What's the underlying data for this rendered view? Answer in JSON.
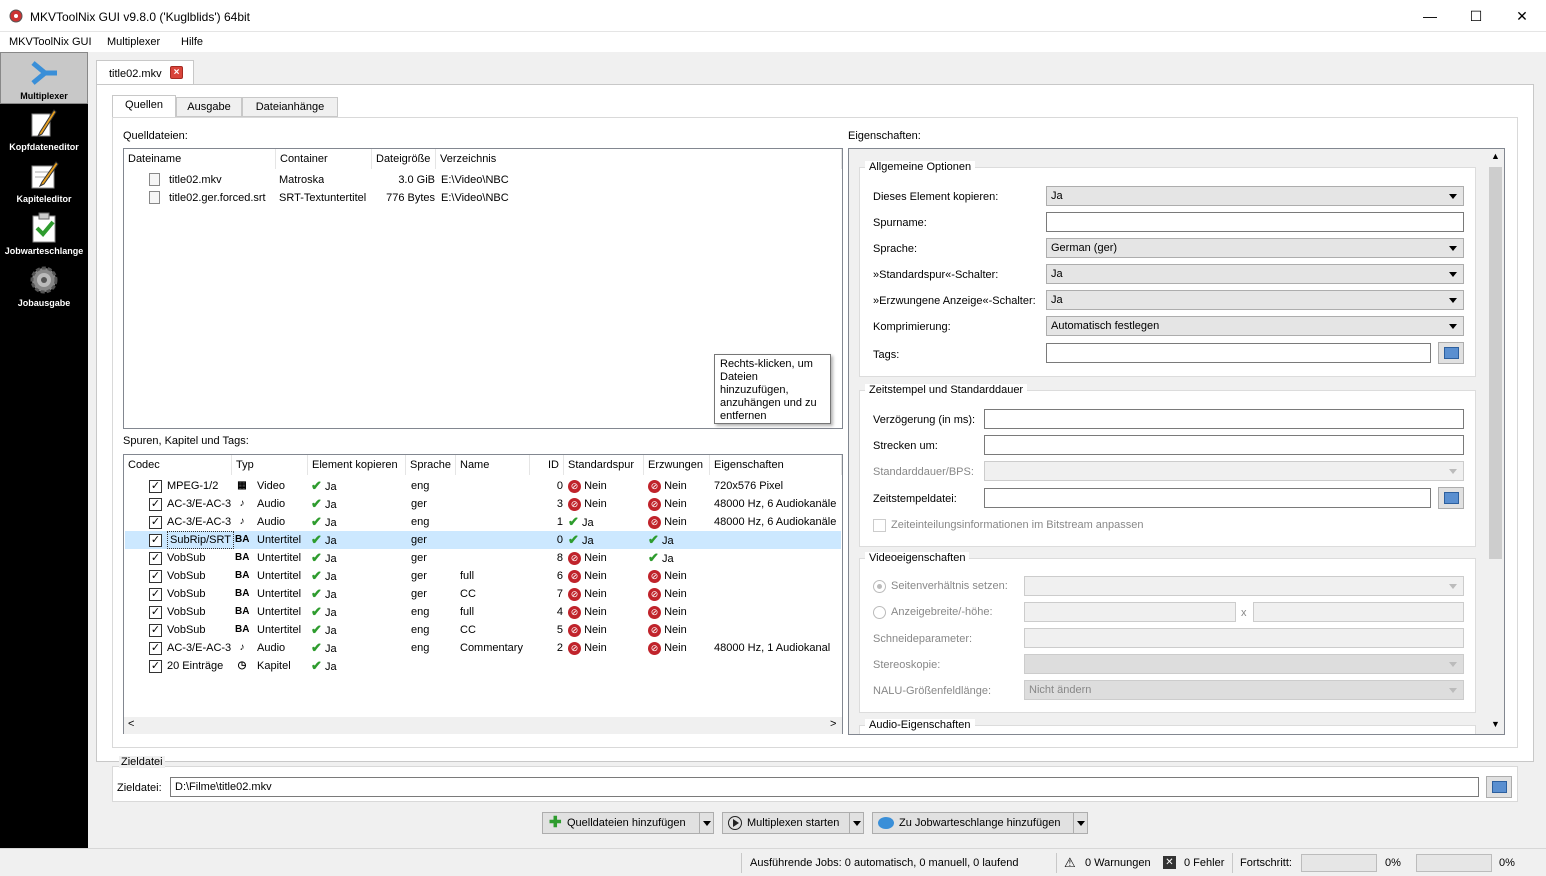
{
  "window": {
    "title": "MKVToolNix GUI v9.8.0 ('Kuglblids') 64bit",
    "min": "—",
    "max": "☐",
    "close": "✕"
  },
  "menu": [
    "MKVToolNix GUI",
    "Multiplexer",
    "Hilfe"
  ],
  "nav": [
    {
      "label": "Multiplexer",
      "icon": "multiplexer-icon"
    },
    {
      "label": "Kopfdateneditor",
      "icon": "header-editor-icon"
    },
    {
      "label": "Kapiteleditor",
      "icon": "chapter-editor-icon"
    },
    {
      "label": "Jobwarteschlange",
      "icon": "job-queue-icon"
    },
    {
      "label": "Jobausgabe",
      "icon": "job-output-icon"
    }
  ],
  "file_tab": {
    "label": "title02.mkv",
    "close": "×"
  },
  "subtabs": [
    "Quellen",
    "Ausgabe",
    "Dateianhänge"
  ],
  "sources": {
    "label": "Quelldateien:",
    "headers": [
      "Dateiname",
      "Container",
      "Dateigröße",
      "Verzeichnis"
    ],
    "rows": [
      {
        "name": "title02.mkv",
        "container": "Matroska",
        "size": "3.0 GiB",
        "dir": "E:\\Video\\NBC"
      },
      {
        "name": "title02.ger.forced.srt",
        "container": "SRT-Textuntertitel",
        "size": "776 Bytes",
        "dir": "E:\\Video\\NBC"
      }
    ],
    "tooltip": "Rechts-klicken, um Dateien hinzuzufügen, anzuhängen und zu entfernen"
  },
  "tracks": {
    "label": "Spuren, Kapitel und Tags:",
    "headers": [
      "Codec",
      "Typ",
      "Element kopieren",
      "Sprache",
      "Name",
      "ID",
      "Standardspur",
      "Erzwungen",
      "Eigenschaften"
    ],
    "rows": [
      {
        "codec": "MPEG-1/2",
        "type": "Video",
        "copy": "Ja",
        "lang": "eng",
        "name": "",
        "id": "0",
        "default": "Nein",
        "forced": "Nein",
        "props": "720x576 Pixel",
        "type_glyph": "▦"
      },
      {
        "codec": "AC-3/E-AC-3",
        "type": "Audio",
        "copy": "Ja",
        "lang": "ger",
        "name": "",
        "id": "3",
        "default": "Nein",
        "forced": "Nein",
        "props": "48000 Hz, 6 Audiokanäle",
        "type_glyph": "♪"
      },
      {
        "codec": "AC-3/E-AC-3",
        "type": "Audio",
        "copy": "Ja",
        "lang": "eng",
        "name": "",
        "id": "1",
        "default": "Ja",
        "forced": "Nein",
        "props": "48000 Hz, 6 Audiokanäle",
        "type_glyph": "♪"
      },
      {
        "codec": "SubRip/SRT",
        "type": "Untertitel",
        "copy": "Ja",
        "lang": "ger",
        "name": "",
        "id": "0",
        "default": "Ja",
        "forced": "Ja",
        "props": "",
        "type_glyph": "BA"
      },
      {
        "codec": "VobSub",
        "type": "Untertitel",
        "copy": "Ja",
        "lang": "ger",
        "name": "",
        "id": "8",
        "default": "Nein",
        "forced": "Ja",
        "props": "",
        "type_glyph": "BA"
      },
      {
        "codec": "VobSub",
        "type": "Untertitel",
        "copy": "Ja",
        "lang": "ger",
        "name": "full",
        "id": "6",
        "default": "Nein",
        "forced": "Nein",
        "props": "",
        "type_glyph": "BA"
      },
      {
        "codec": "VobSub",
        "type": "Untertitel",
        "copy": "Ja",
        "lang": "ger",
        "name": "CC",
        "id": "7",
        "default": "Nein",
        "forced": "Nein",
        "props": "",
        "type_glyph": "BA"
      },
      {
        "codec": "VobSub",
        "type": "Untertitel",
        "copy": "Ja",
        "lang": "eng",
        "name": "full",
        "id": "4",
        "default": "Nein",
        "forced": "Nein",
        "props": "",
        "type_glyph": "BA"
      },
      {
        "codec": "VobSub",
        "type": "Untertitel",
        "copy": "Ja",
        "lang": "eng",
        "name": "CC",
        "id": "5",
        "default": "Nein",
        "forced": "Nein",
        "props": "",
        "type_glyph": "BA"
      },
      {
        "codec": "AC-3/E-AC-3",
        "type": "Audio",
        "copy": "Ja",
        "lang": "eng",
        "name": "Commentary",
        "id": "2",
        "default": "Nein",
        "forced": "Nein",
        "props": "48000 Hz, 1 Audiokanal",
        "type_glyph": "♪"
      },
      {
        "codec": "20 Einträge",
        "type": "Kapitel",
        "copy": "Ja",
        "lang": "",
        "name": "",
        "id": "",
        "default": "",
        "forced": "",
        "props": "",
        "type_glyph": "◷"
      }
    ],
    "selected_row": 3,
    "scroll_left": "<",
    "scroll_right": ">"
  },
  "props": {
    "label": "Eigenschaften:",
    "general": {
      "title": "Allgemeine Optionen",
      "copy_label": "Dieses Element kopieren:",
      "copy_value": "Ja",
      "name_label": "Spurname:",
      "name_value": "",
      "lang_label": "Sprache:",
      "lang_value": "German (ger)",
      "default_label": "»Standardspur«-Schalter:",
      "default_value": "Ja",
      "forced_label": "»Erzwungene Anzeige«-Schalter:",
      "forced_value": "Ja",
      "compress_label": "Komprimierung:",
      "compress_value": "Automatisch festlegen",
      "tags_label": "Tags:",
      "tags_value": ""
    },
    "timestamps": {
      "title": "Zeitstempel und Standarddauer",
      "delay_label": "Verzögerung (in ms):",
      "stretch_label": "Strecken um:",
      "duration_label": "Standarddauer/BPS:",
      "file_label": "Zeitstempeldatei:",
      "fix_label": "Zeiteinteilungsinformationen im Bitstream anpassen"
    },
    "video": {
      "title": "Videoeigenschaften",
      "aspect_label": "Seitenverhältnis setzen:",
      "display_label": "Anzeigebreite/-höhe:",
      "x": "x",
      "crop_label": "Schneideparameter:",
      "stereo_label": "Stereoskopie:",
      "nalu_label": "NALU-Größenfeldlänge:",
      "nalu_value": "Nicht ändern"
    },
    "audio": {
      "title": "Audio-Eigenschaften"
    }
  },
  "output": {
    "group": "Zieldatei",
    "label": "Zieldatei:",
    "value": "D:\\Filme\\title02.mkv"
  },
  "actions": {
    "add": "Quelldateien hinzufügen",
    "start": "Multiplexen starten",
    "queue": "Zu Jobwarteschlange hinzufügen"
  },
  "status": {
    "jobs": "Ausführende Jobs:  0 automatisch, 0 manuell, 0 laufend",
    "warnings": "0 Warnungen",
    "errors": "0 Fehler",
    "progress_label": "Fortschritt:",
    "progress1": "0%",
    "progress2": "0%"
  },
  "colors": {
    "sidebar": "#000000",
    "selection": "#cce8ff",
    "check": "#2e9c2e",
    "nein": "#c0232b"
  }
}
